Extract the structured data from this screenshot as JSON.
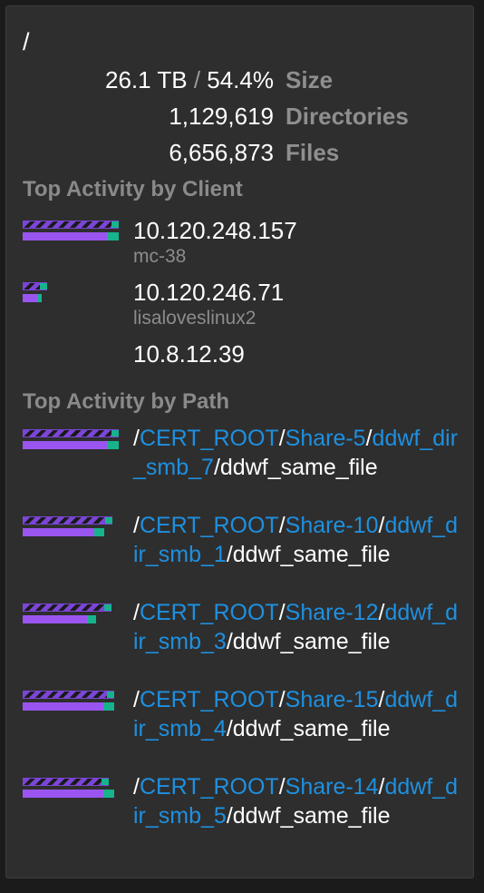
{
  "root": {
    "path": "/"
  },
  "stats": {
    "size_value": "26.1 TB",
    "size_sep": " / ",
    "size_percent": "54.4%",
    "size_label": "Size",
    "dirs_value": "1,129,619",
    "dirs_label": "Directories",
    "files_value": "6,656,873",
    "files_label": "Files"
  },
  "clients": {
    "title": "Top Activity by Client",
    "items": [
      {
        "name": "10.120.248.157",
        "sub": "mc-38",
        "bar": {
          "top": 1.0,
          "bottom": 1.0
        }
      },
      {
        "name": "10.120.246.71",
        "sub": "lisaloveslinux2",
        "bar": {
          "top": 0.25,
          "bottom": 0.2
        }
      },
      {
        "name": "10.8.12.39",
        "sub": "",
        "bar": {
          "top": 0,
          "bottom": 0
        }
      }
    ]
  },
  "paths": {
    "title": "Top Activity by Path",
    "items": [
      {
        "root": "CERT_ROOT",
        "share": "Share-5",
        "dir": "ddwf_dir_smb_7",
        "file": "ddwf_same_file",
        "bar": {
          "top": 1.0,
          "bottom": 1.0
        }
      },
      {
        "root": "CERT_ROOT",
        "share": "Share-10",
        "dir": "ddwf_dir_smb_1",
        "file": "ddwf_same_file",
        "bar": {
          "top": 0.93,
          "bottom": 0.85
        }
      },
      {
        "root": "CERT_ROOT",
        "share": "Share-12",
        "dir": "ddwf_dir_smb_3",
        "file": "ddwf_same_file",
        "bar": {
          "top": 0.92,
          "bottom": 0.76
        }
      },
      {
        "root": "CERT_ROOT",
        "share": "Share-15",
        "dir": "ddwf_dir_smb_4",
        "file": "ddwf_same_file",
        "bar": {
          "top": 0.95,
          "bottom": 0.95
        }
      },
      {
        "root": "CERT_ROOT",
        "share": "Share-14",
        "dir": "ddwf_dir_smb_5",
        "file": "ddwf_same_file",
        "bar": {
          "top": 0.9,
          "bottom": 0.95
        }
      }
    ]
  },
  "colors": {
    "background": "#2e2e2e",
    "link": "#1e90e0",
    "bar_purple": "#9a55f0",
    "bar_green": "#16b38c",
    "label_gray": "#8f8f8f"
  }
}
